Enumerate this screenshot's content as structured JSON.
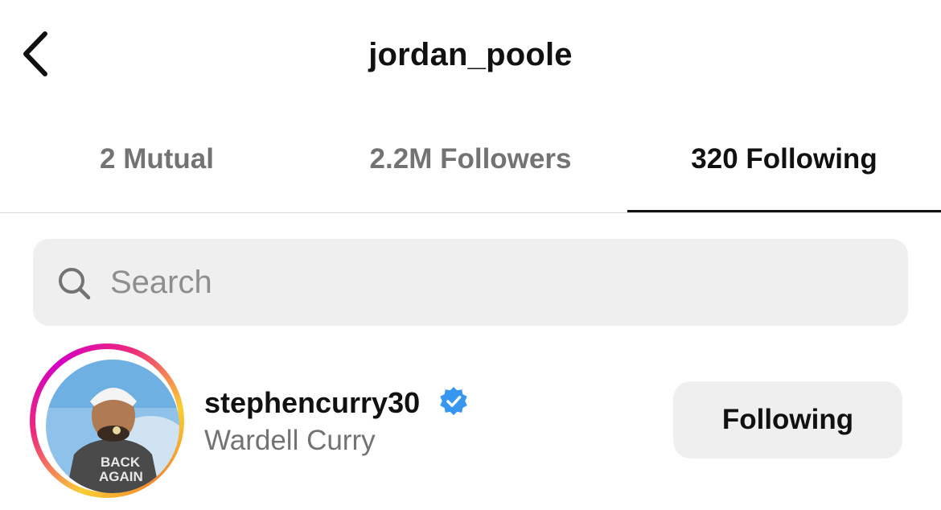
{
  "header": {
    "title": "jordan_poole",
    "back_icon": "chevron-left-icon"
  },
  "tabs": [
    {
      "label": "2 Mutual",
      "active": false
    },
    {
      "label": "2.2M Followers",
      "active": false
    },
    {
      "label": "320 Following",
      "active": true
    }
  ],
  "search": {
    "placeholder": "Search",
    "value": "",
    "icon": "search-icon"
  },
  "list": [
    {
      "username": "stephencurry30",
      "full_name": "Wardell Curry",
      "verified": true,
      "button_label": "Following",
      "avatar_shirt_text": "BACK AGAIN"
    }
  ],
  "colors": {
    "verified_blue": "#3797f0",
    "secondary_text": "#737373",
    "button_bg": "#efefef",
    "story_ring": [
      "#f9ce34",
      "#ee2a7b",
      "#d300c5"
    ]
  }
}
